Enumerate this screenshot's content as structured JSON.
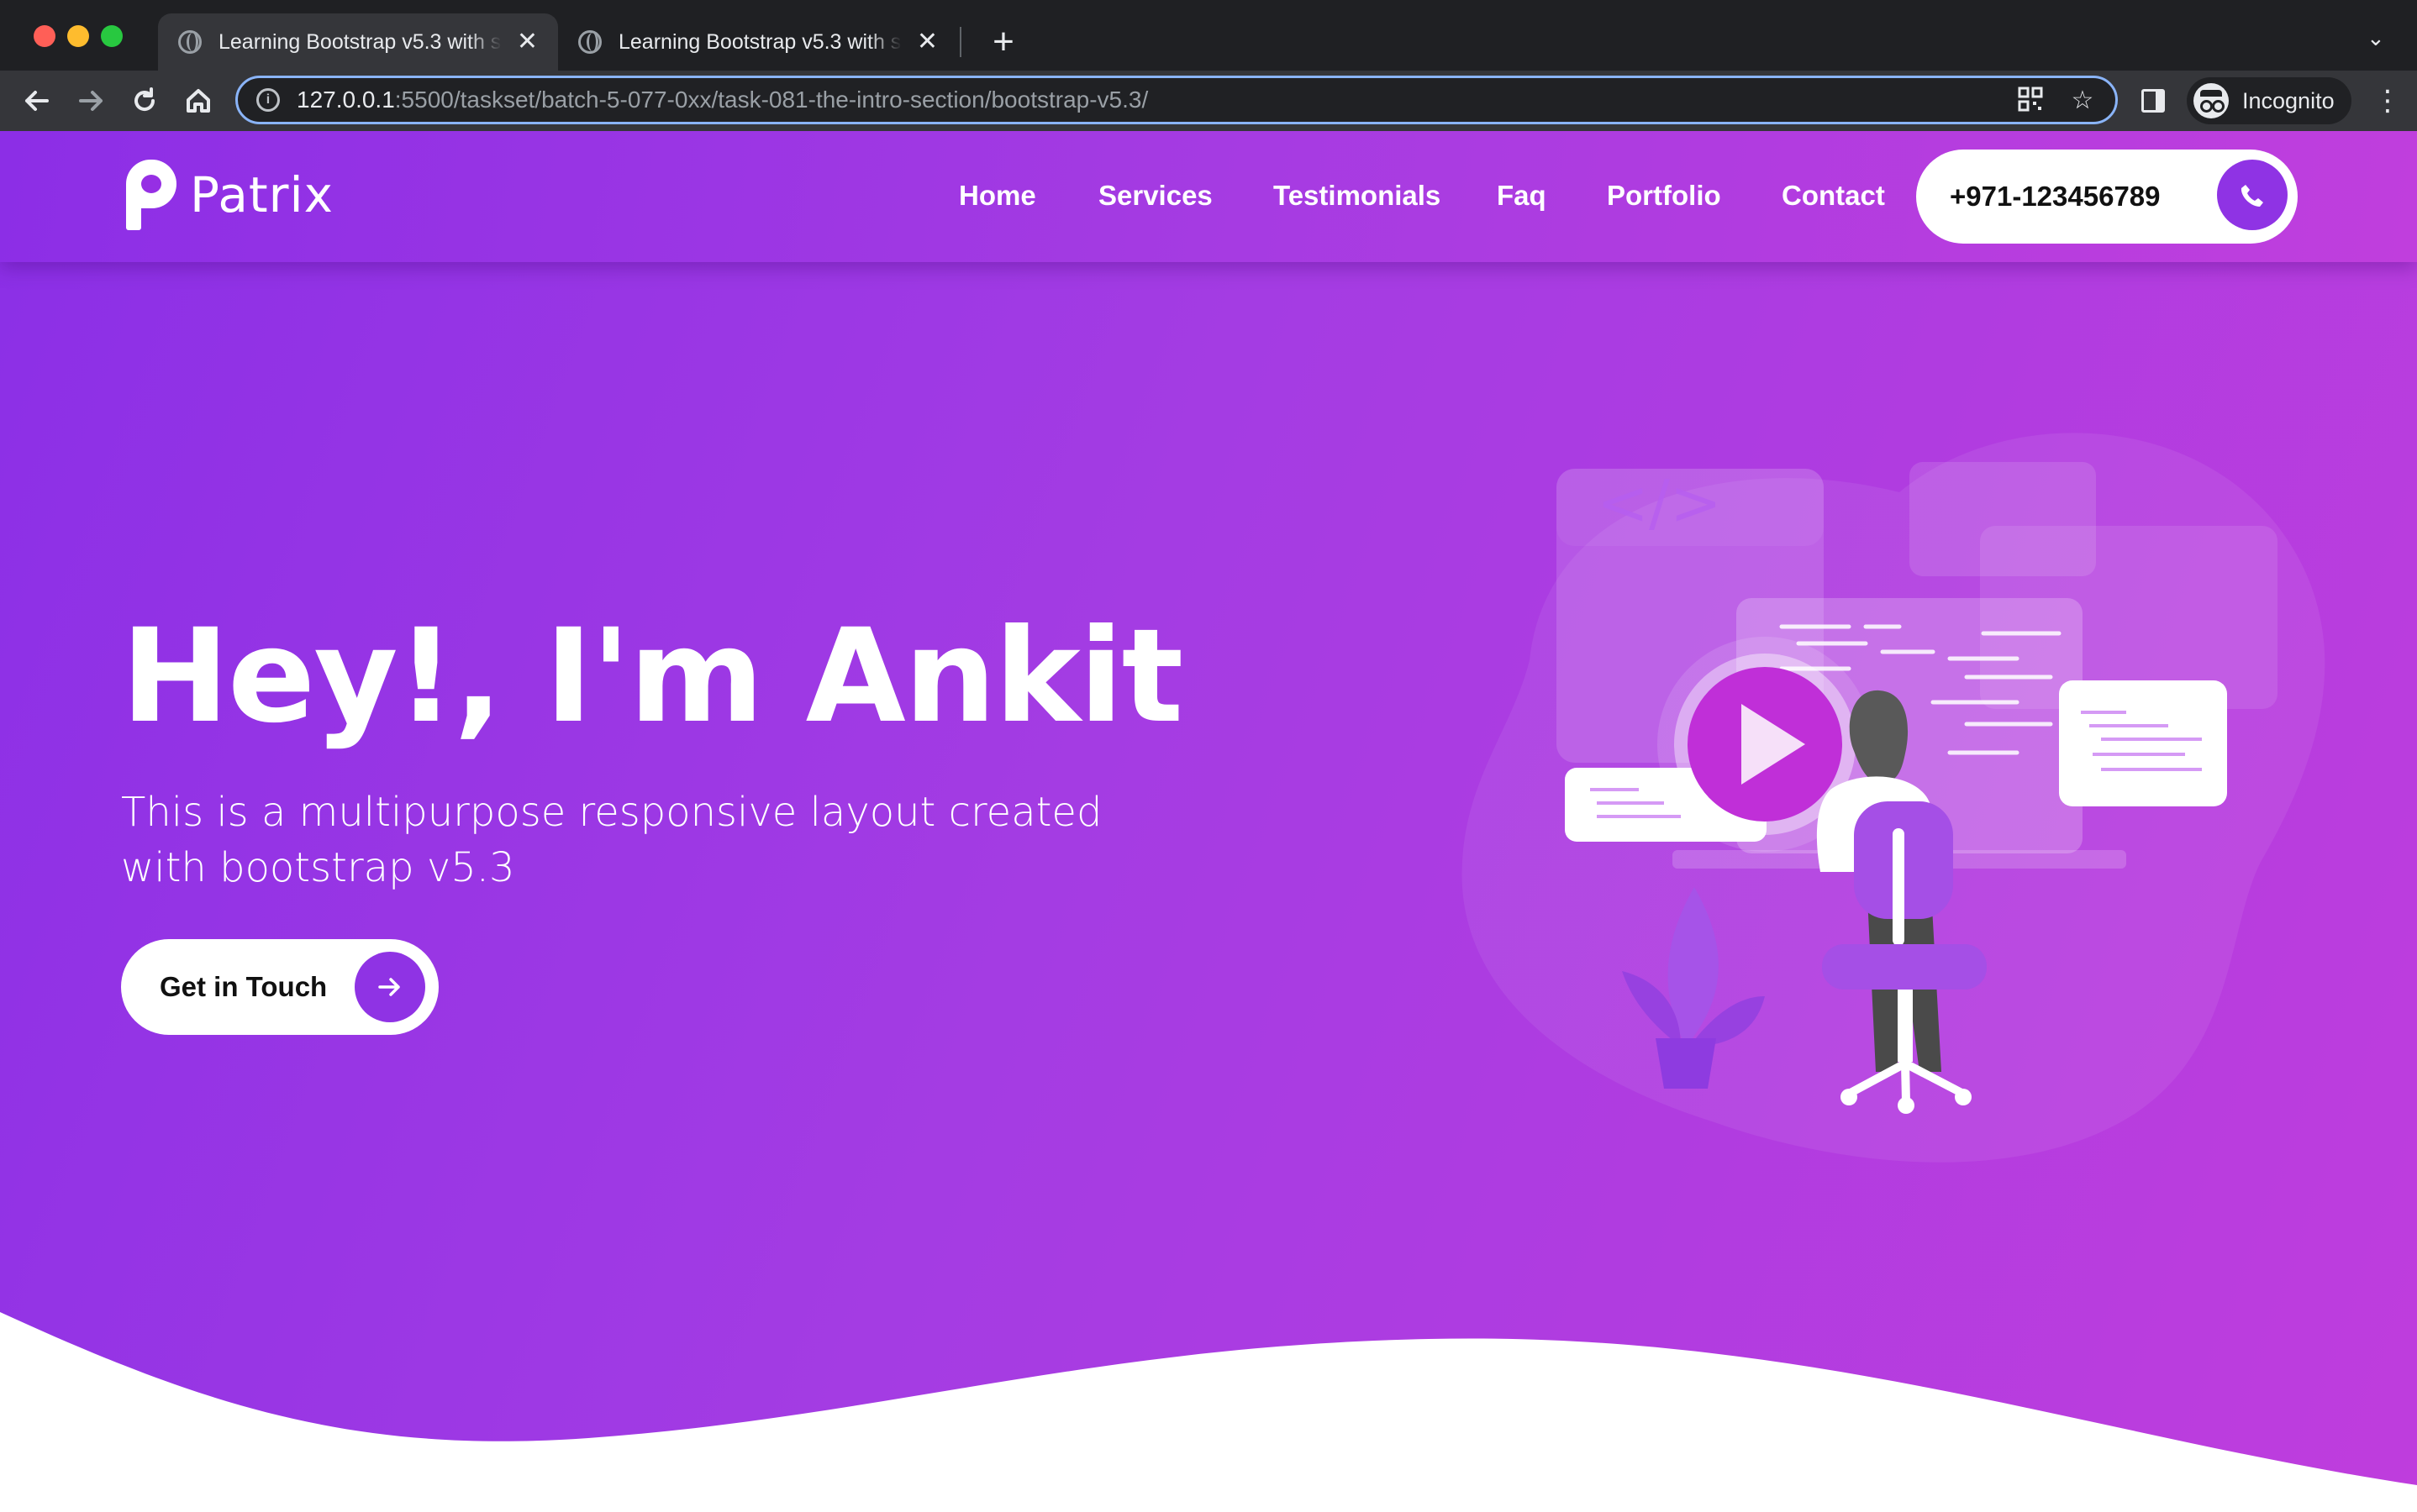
{
  "browser": {
    "tabs": [
      {
        "title": "Learning Bootstrap v5.3 with s",
        "active": true
      },
      {
        "title": "Learning Bootstrap v5.3 with s",
        "active": false
      }
    ],
    "new_tab_icon": "plus-icon",
    "url_host": "127.0.0.1",
    "url_path": ":5500/taskset/batch-5-077-0xx/task-081-the-intro-section/bootstrap-v5.3/",
    "incognito_label": "Incognito"
  },
  "site": {
    "brand": "Patrix",
    "nav": [
      {
        "label": "Home"
      },
      {
        "label": "Services"
      },
      {
        "label": "Testimonials"
      },
      {
        "label": "Faq"
      },
      {
        "label": "Portfolio"
      },
      {
        "label": "Contact"
      }
    ],
    "phone": "+971-123456789"
  },
  "hero": {
    "title": "Hey!, I'm Ankit",
    "subtitle": "This is a multipurpose responsive layout created with bootstrap v5.3",
    "cta_label": "Get in Touch"
  },
  "colors": {
    "gradient_start": "#8b2fe6",
    "gradient_end": "#bf3ddd",
    "accent": "#8f33e4",
    "play_button": "#c02fd8"
  }
}
